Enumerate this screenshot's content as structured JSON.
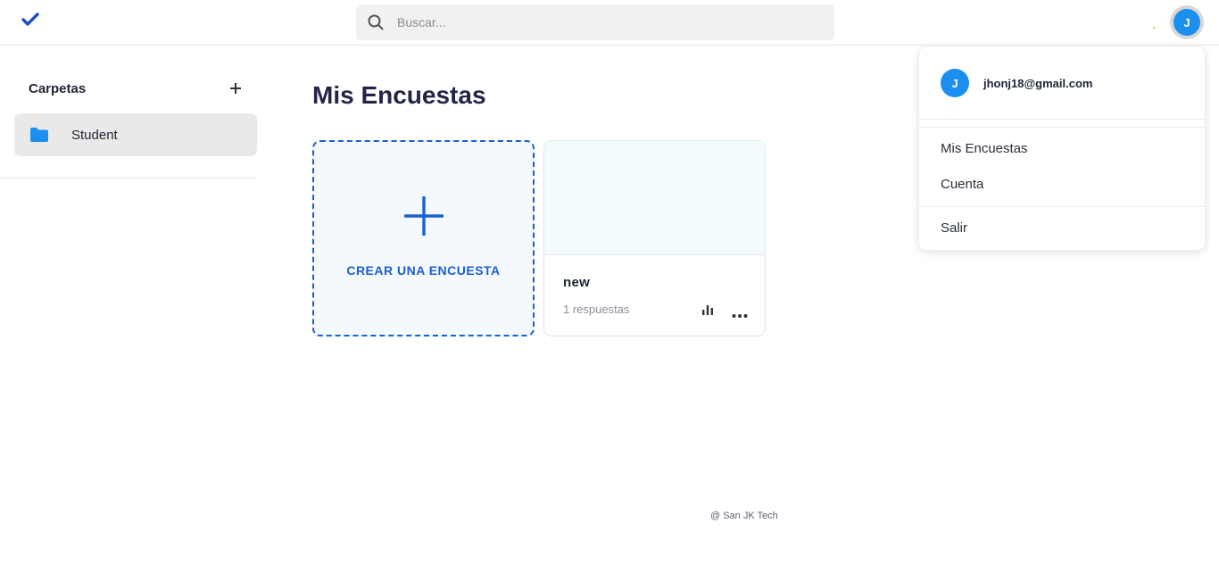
{
  "header": {
    "logo_icon": "checkmark-icon",
    "search": {
      "placeholder": "Buscar...",
      "value": "",
      "icon": "search-icon"
    },
    "avatar_initial": "J"
  },
  "sidebar": {
    "title": "Carpetas",
    "add_icon": "plus-icon",
    "folders": [
      {
        "label": "Student",
        "icon": "folder-icon"
      }
    ]
  },
  "main": {
    "title": "Mis Encuestas",
    "create_card": {
      "label": "CREAR UNA ENCUESTA",
      "icon": "plus-icon"
    },
    "surveys": [
      {
        "name": "new",
        "responses": "1 respuestas",
        "stats_icon": "bar-chart-icon",
        "menu_icon": "more-horizontal-icon"
      }
    ]
  },
  "footer": {
    "text": "@ San JK Tech"
  },
  "user_menu": {
    "avatar_initial": "J",
    "email": "jhonj18@gmail.com",
    "items": [
      "Mis Encuestas",
      "Cuenta",
      "Salir"
    ]
  },
  "colors": {
    "accent": "#1a5fd6",
    "avatar": "#1b8ff0",
    "folder": "#1b8ff0"
  }
}
